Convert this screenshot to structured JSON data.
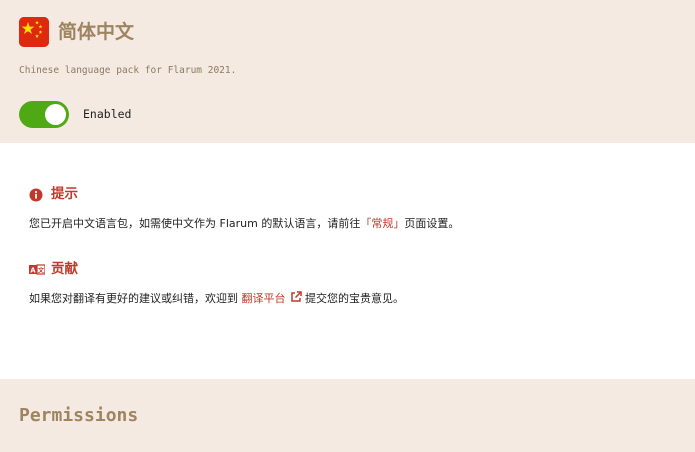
{
  "extension": {
    "title": "简体中文",
    "description": "Chinese language pack for Flarum 2021.",
    "icon": "china-flag-icon",
    "enabled": true,
    "toggle_label": "Enabled"
  },
  "tip": {
    "icon": "info-circle-icon",
    "heading": "提示",
    "text_before": "您已开启中文语言包，如需使中文作为 Flarum 的默认语言，请前往",
    "highlight": "「常规」",
    "text_after": "页面设置。"
  },
  "contribute": {
    "icon": "language-icon",
    "heading": "贡献",
    "text_before": "如果您对翻译有更好的建议或纠错，欢迎到",
    "link_label": "翻译平台",
    "link_icon": "external-link-icon",
    "text_after": "提交您的宝贵意见。"
  },
  "permissions": {
    "heading": "Permissions"
  },
  "colors": {
    "header_bg": "#f4eae1",
    "title": "#9e8461",
    "accent_red": "#c0392b",
    "toggle_on": "#4fa914"
  }
}
